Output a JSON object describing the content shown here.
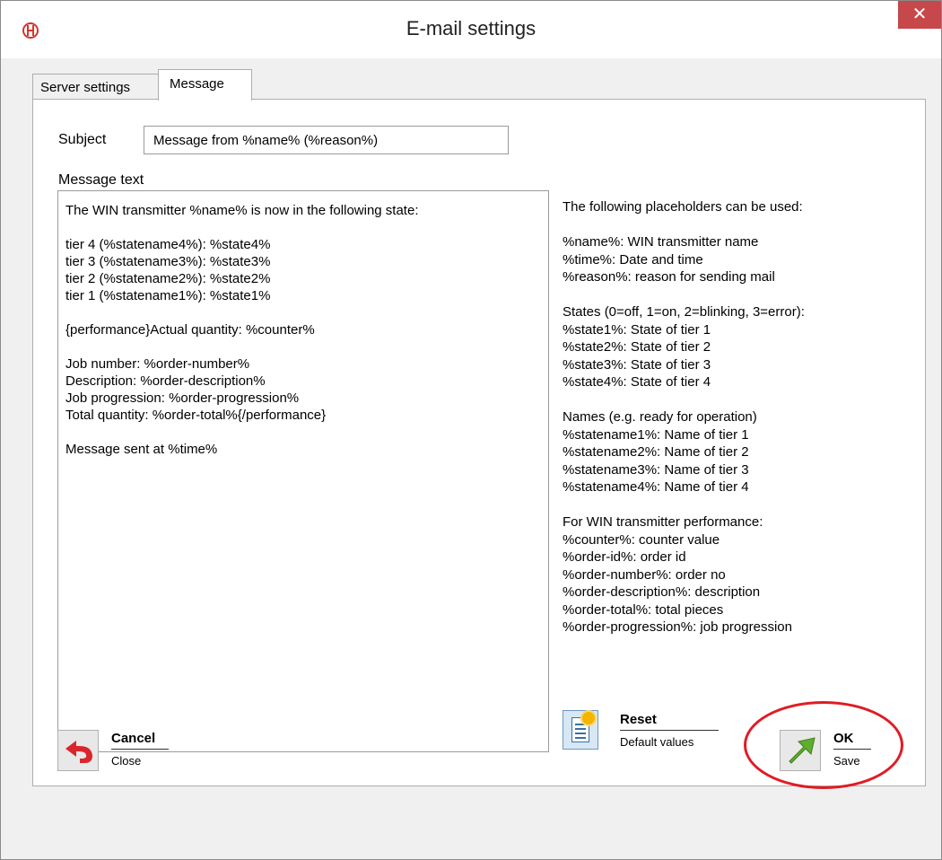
{
  "window": {
    "title": "E-mail settings",
    "close_label": "✕"
  },
  "tabs": [
    {
      "label": "Server settings"
    },
    {
      "label": "Message"
    }
  ],
  "subject": {
    "label": "Subject",
    "value": "Message from %name% (%reason%)"
  },
  "message": {
    "label": "Message text",
    "value": "The WIN transmitter %name% is now in the following state:\n\ntier 4 (%statename4%): %state4%\ntier 3 (%statename3%): %state3%\ntier 2 (%statename2%): %state2%\ntier 1 (%statename1%): %state1%\n\n{performance}Actual quantity: %counter%\n\nJob number: %order-number%\nDescription: %order-description%\nJob progression: %order-progression%\nTotal quantity: %order-total%{/performance}\n\nMessage sent at %time%"
  },
  "help": {
    "text": "The following placeholders can be used:\n\n%name%: WIN transmitter name\n%time%: Date and time\n%reason%: reason for sending mail\n\nStates (0=off, 1=on, 2=blinking, 3=error):\n%state1%: State of tier 1\n%state2%: State of tier 2\n%state3%: State of tier 3\n%state4%: State of tier 4\n\nNames (e.g. ready for operation)\n%statename1%: Name of tier 1\n%statename2%: Name of tier 2\n%statename3%: Name of tier 3\n%statename4%: Name of tier 4\n\nFor WIN transmitter performance:\n%counter%: counter value\n%order-id%: order id\n%order-number%: order no\n%order-description%: description\n%order-total%: total pieces\n%order-progression%: job progression"
  },
  "reset": {
    "title": "Reset",
    "subtitle": "Default values"
  },
  "cancel": {
    "title": "Cancel",
    "subtitle": "Close"
  },
  "ok": {
    "title": "OK",
    "subtitle": "Save"
  },
  "colors": {
    "close_button": "#c7484a",
    "highlight_ring": "#e01b24",
    "ok_arrow": "#5fae2e",
    "cancel_arrow": "#d9262c"
  }
}
